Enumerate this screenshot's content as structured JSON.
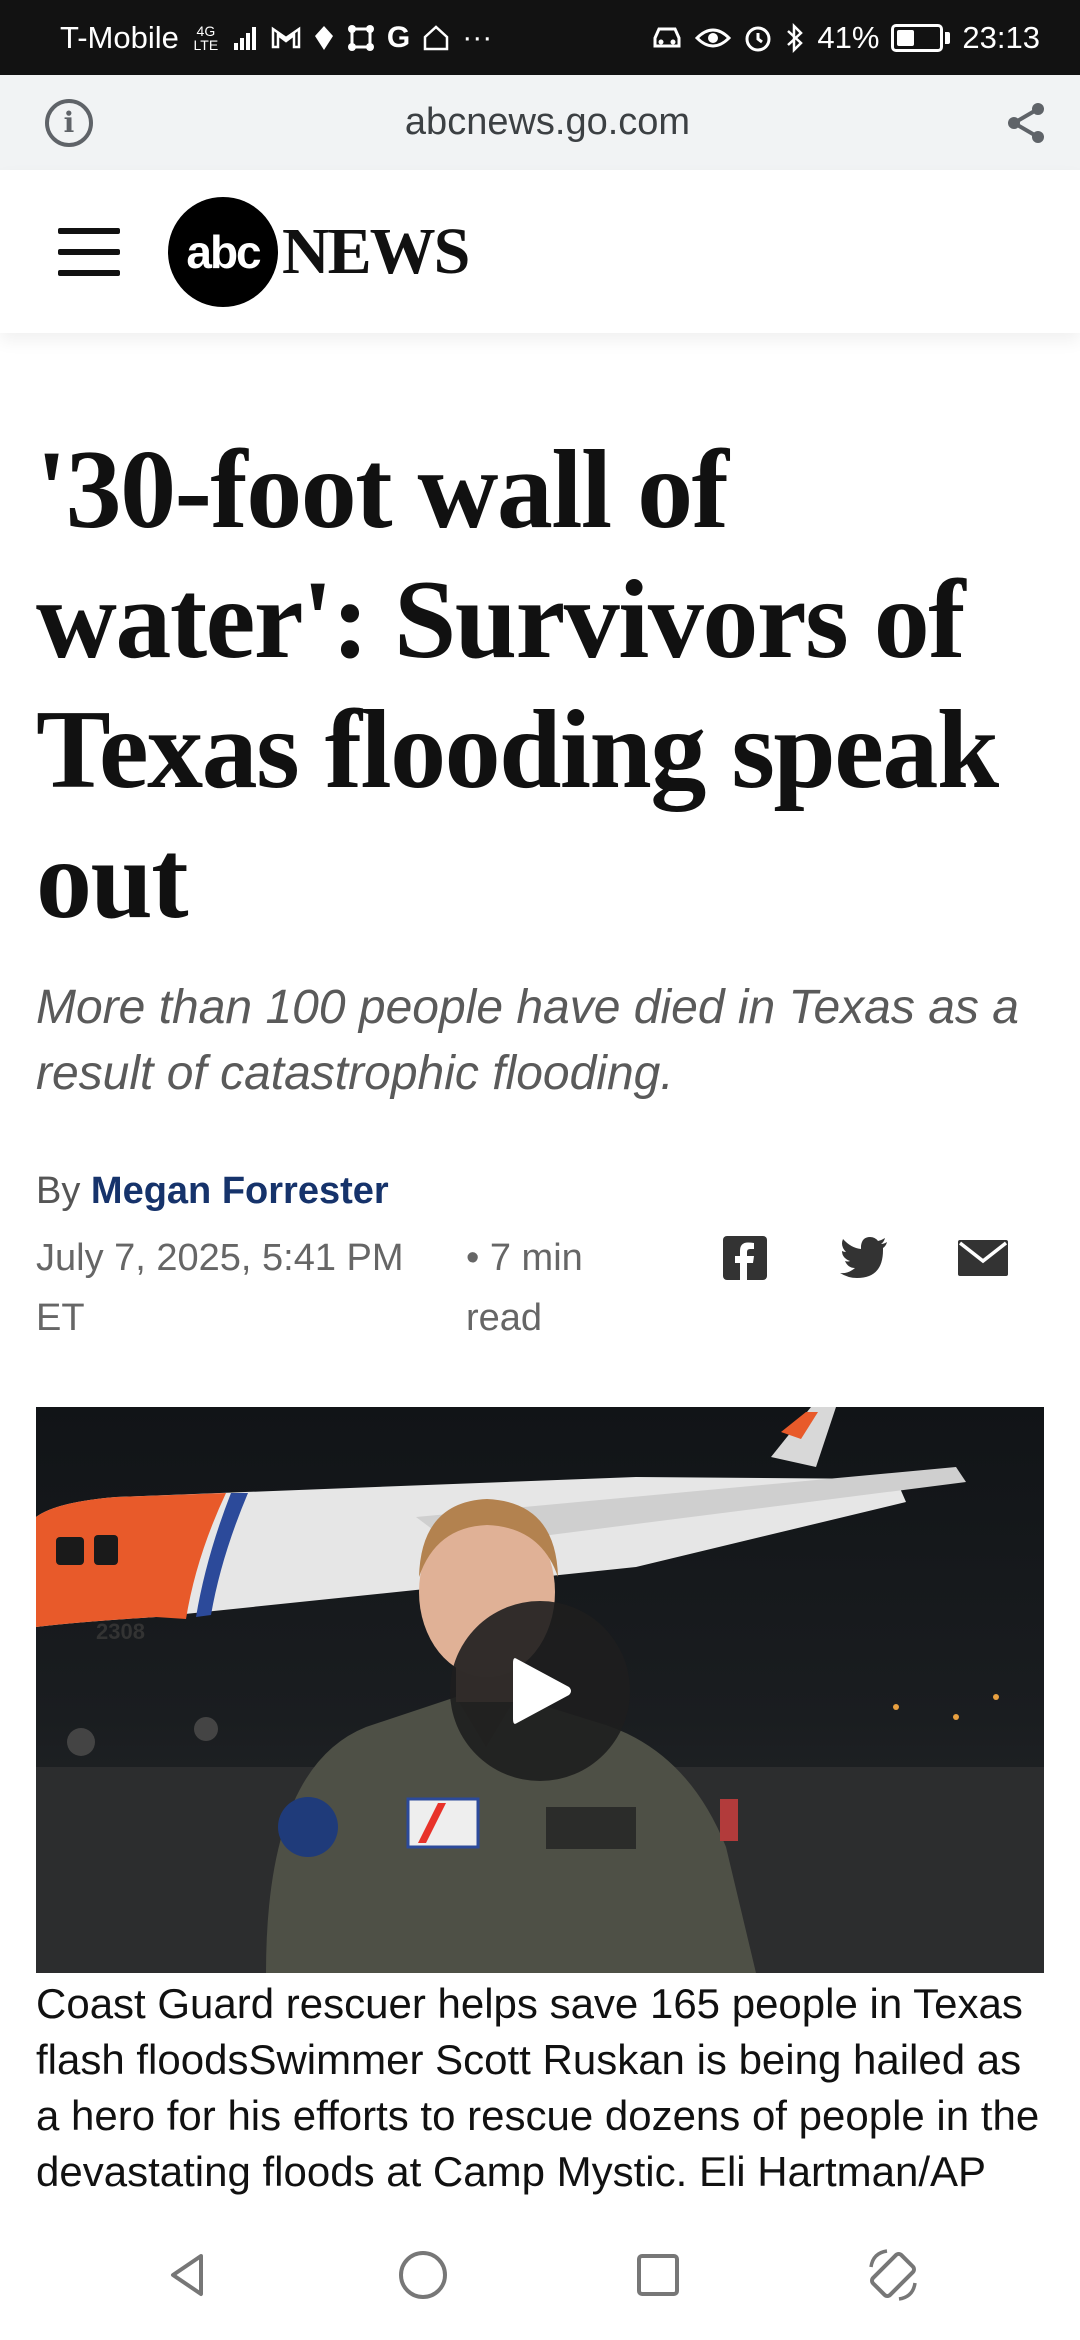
{
  "status_bar": {
    "carrier": "T-Mobile",
    "network": "4G LTE",
    "battery_percent": "41%",
    "battery_level": 0.41,
    "time": "23:13",
    "left_icons": [
      "signal-icon",
      "gmail-icon",
      "location-icon",
      "app-icon",
      "google-icon",
      "home-icon",
      "more-icon"
    ],
    "right_icons": [
      "car-icon",
      "eye-icon",
      "alarm-icon",
      "bluetooth-icon"
    ]
  },
  "browser": {
    "url": "abcnews.go.com"
  },
  "header": {
    "logo_abc": "abc",
    "logo_news": "NEWS"
  },
  "article": {
    "headline": "'30-foot wall of water': Survivors of Texas flooding speak out",
    "subheadline": "More than 100 people have died in Texas as a result of catastrophic flooding.",
    "by_label": "By",
    "author": "Megan Forrester",
    "date": "July 7, 2025, 5:41 PM ET",
    "read_time": "• 7 min read"
  },
  "video": {
    "caption": "Coast Guard rescuer helps save 165 people in Texas flash floodsSwimmer Scott Ruskan is being hailed as a hero for his efforts to rescue dozens of people in the devastating floods at Camp Mystic. Eli Hartman/AP"
  },
  "colors": {
    "author": "#16336b",
    "status_bar": "#121212",
    "url_bar": "#f1f3f4",
    "coast_guard_orange": "#e85a2a"
  }
}
